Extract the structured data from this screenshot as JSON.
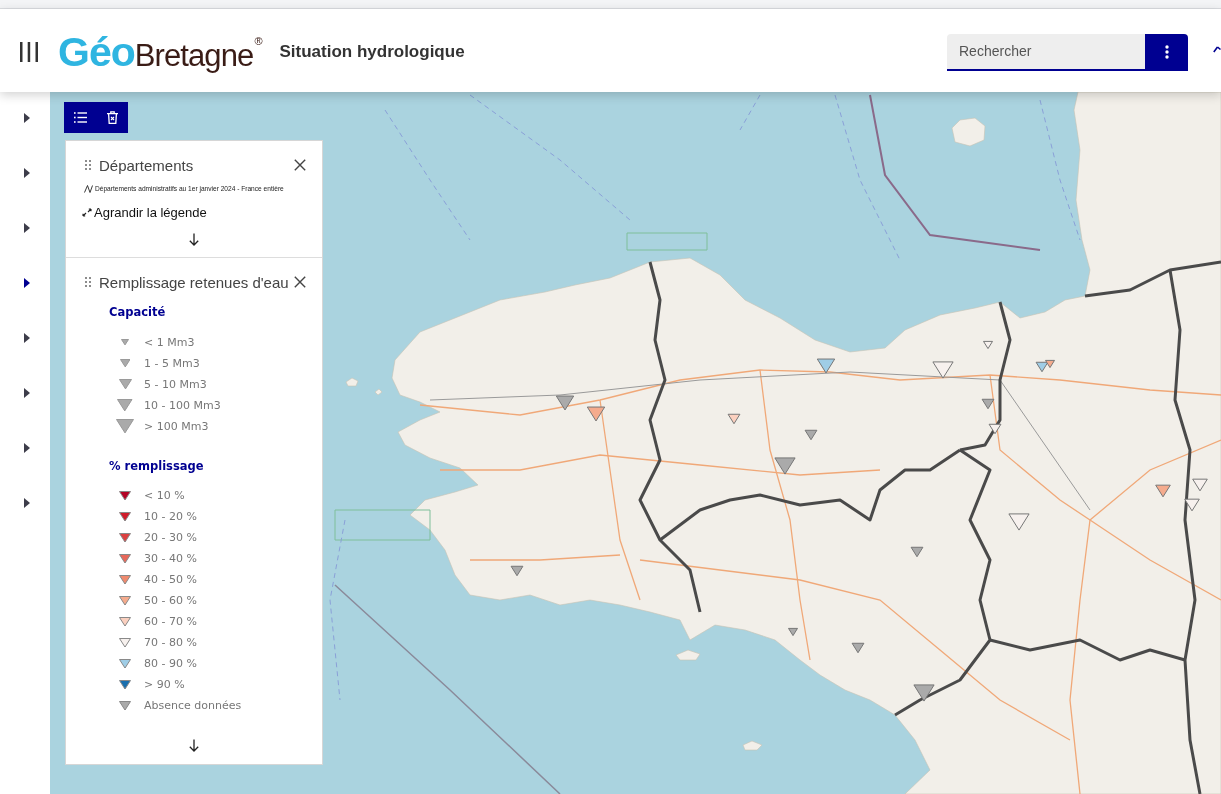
{
  "header": {
    "logo": {
      "prefix": "Géo",
      "name": "Bretagne",
      "mark": "®"
    },
    "title": "Situation hydrologique",
    "search": {
      "placeholder": "Rechercher"
    }
  },
  "sidebar": {
    "toggles": [
      {
        "selected": false
      },
      {
        "selected": false
      },
      {
        "selected": false
      },
      {
        "selected": true
      },
      {
        "selected": false
      },
      {
        "selected": false
      },
      {
        "selected": false
      },
      {
        "selected": false
      }
    ]
  },
  "legend": {
    "layers": [
      {
        "kind": "line",
        "title": "Départements",
        "description": "Départements administratifs au 1er janvier 2024 - France entière",
        "expand_link": "Agrandir la légende"
      },
      {
        "kind": "classes",
        "title": "Remplissage retenues d'eau",
        "sections": [
          {
            "kind": "size",
            "heading": "Capacité",
            "items": [
              {
                "label": "< 1 Mm3"
              },
              {
                "label": "1 - 5 Mm3"
              },
              {
                "label": "5 - 10 Mm3"
              },
              {
                "label": "10 - 100 Mm3"
              },
              {
                "label": "> 100 Mm3"
              }
            ]
          },
          {
            "kind": "color",
            "heading": "% remplissage",
            "items": [
              {
                "label": "< 10 %",
                "color": "#b40426"
              },
              {
                "label": "10 - 20 %",
                "color": "#d01c2b"
              },
              {
                "label": "20 - 30 %",
                "color": "#dc4040"
              },
              {
                "label": "30 - 40 %",
                "color": "#e8685a"
              },
              {
                "label": "40 - 50 %",
                "color": "#f08a6e"
              },
              {
                "label": "50 - 60 %",
                "color": "#f5ab8d"
              },
              {
                "label": "60 - 70 %",
                "color": "#fbd0bf"
              },
              {
                "label": "70 - 80 %",
                "color": "#f7f1ee"
              },
              {
                "label": "80 - 90 %",
                "color": "#9fcde6"
              },
              {
                "label": "> 90 %",
                "color": "#1a6fae"
              },
              {
                "label": "Absence données",
                "color": "#aaaaaa"
              }
            ]
          }
        ]
      }
    ]
  }
}
